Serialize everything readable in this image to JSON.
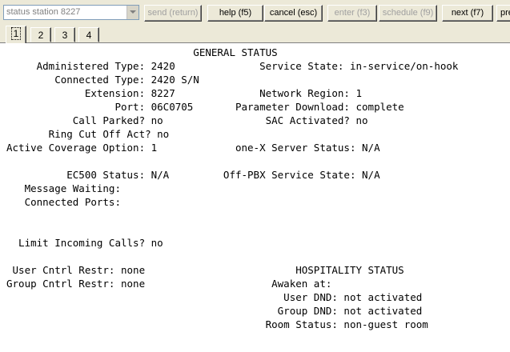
{
  "toolbar": {
    "command_value": "status station 8227",
    "buttons": {
      "send": "send (return)",
      "help": "help (f5)",
      "cancel": "cancel (esc)",
      "enter": "enter (f3)",
      "schedule": "schedule (f9)",
      "next": "next (f7)",
      "prev": "prev"
    }
  },
  "tabs": [
    "1",
    "2",
    "3",
    "4"
  ],
  "screen": {
    "lines": [
      "                               GENERAL STATUS",
      "     Administered Type: 2420              Service State: in-service/on-hook",
      "        Connected Type: 2420 S/N",
      "             Extension: 8227              Network Region: 1",
      "                  Port: 06C0705       Parameter Download: complete",
      "           Call Parked? no                 SAC Activated? no",
      "       Ring Cut Off Act? no",
      "Active Coverage Option: 1             one-X Server Status: N/A",
      "",
      "          EC500 Status: N/A         Off-PBX Service State: N/A",
      "   Message Waiting:",
      "   Connected Ports:",
      "",
      "",
      "  Limit Incoming Calls? no",
      "",
      " User Cntrl Restr: none                         HOSPITALITY STATUS",
      "Group Cntrl Restr: none                     Awaken at:",
      "                                              User DND: not activated",
      "                                             Group DND: not activated",
      "                                           Room Status: non-guest room"
    ]
  }
}
